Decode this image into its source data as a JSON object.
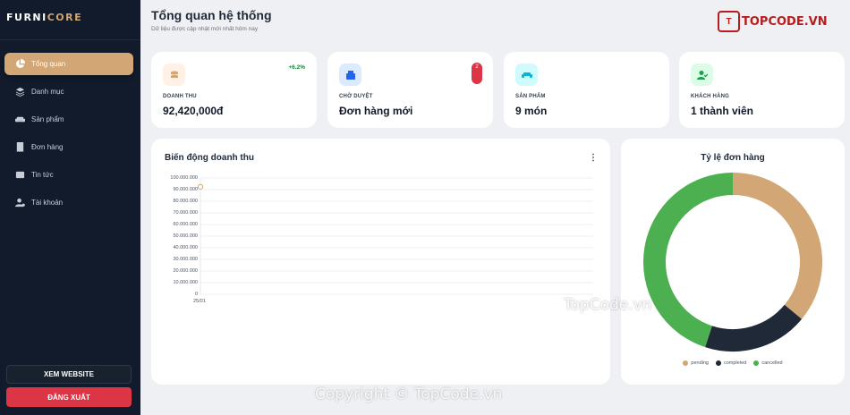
{
  "sidebar": {
    "logo_a": "FURNI",
    "logo_b": "CORE",
    "items": [
      {
        "label": "Tổng quan",
        "icon": "pie-chart-icon",
        "active": true
      },
      {
        "label": "Danh mục",
        "icon": "layers-icon",
        "active": false
      },
      {
        "label": "Sản phẩm",
        "icon": "sofa-icon",
        "active": false
      },
      {
        "label": "Đơn hàng",
        "icon": "receipt-icon",
        "active": false
      },
      {
        "label": "Tin tức",
        "icon": "newspaper-icon",
        "active": false
      },
      {
        "label": "Tài khoản",
        "icon": "users-cog-icon",
        "active": false
      }
    ],
    "website_label": "XEM WEBSITE",
    "logout_label": "ĐĂNG XUẤT"
  },
  "header": {
    "title": "Tổng quan hệ thống",
    "subtitle": "Dữ liệu được cập nhật mới nhất hôm nay"
  },
  "brand": {
    "mark": "T",
    "text": "TOPCODE.VN"
  },
  "stats": [
    {
      "label": "DOANH THU",
      "value": "92,420,000đ",
      "trend": "+6.2%",
      "icon": "coins-icon",
      "icon_bg": "#fff1e6",
      "icon_color": "#d2a675"
    },
    {
      "label": "CHỜ DUYỆT",
      "value": "Đơn hàng mới",
      "badge": "2",
      "icon": "box-icon",
      "icon_bg": "#dbeafe",
      "icon_color": "#2563eb"
    },
    {
      "label": "SẢN PHẨM",
      "value": "9 món",
      "icon": "couch-icon",
      "icon_bg": "#cffafe",
      "icon_color": "#06b6d4"
    },
    {
      "label": "KHÁCH HÀNG",
      "value": "1 thành viên",
      "icon": "user-check-icon",
      "icon_bg": "#dcfce7",
      "icon_color": "#16a34a"
    }
  ],
  "revenue_panel": {
    "title": "Biến động doanh thu",
    "more": "⋮"
  },
  "ratio_panel": {
    "title": "Tỷ lệ đơn hàng"
  },
  "chart_data": [
    {
      "type": "line",
      "title": "Biến động doanh thu",
      "x": [
        "25/01"
      ],
      "series": [
        {
          "values": [
            92420000
          ]
        }
      ],
      "y_ticks": [
        "100.000.000",
        "90.000.000",
        "80.000.000",
        "70.000.000",
        "60.000.000",
        "50.000.000",
        "40.000.000",
        "30.000.000",
        "20.000.000",
        "10.000.000",
        "0"
      ],
      "ylim": [
        0,
        100000000
      ],
      "grid": true,
      "color": "#d2a675"
    },
    {
      "type": "pie",
      "title": "Tỷ lệ đơn hàng",
      "categories": [
        "pending",
        "completed",
        "cancelled"
      ],
      "values": [
        36,
        19,
        45
      ],
      "colors": [
        "#d2a675",
        "#1f2937",
        "#4caf50"
      ],
      "legend": "bottom"
    }
  ],
  "watermarks": [
    "TopCode.vn",
    "Copyright © TopCode.vn"
  ]
}
